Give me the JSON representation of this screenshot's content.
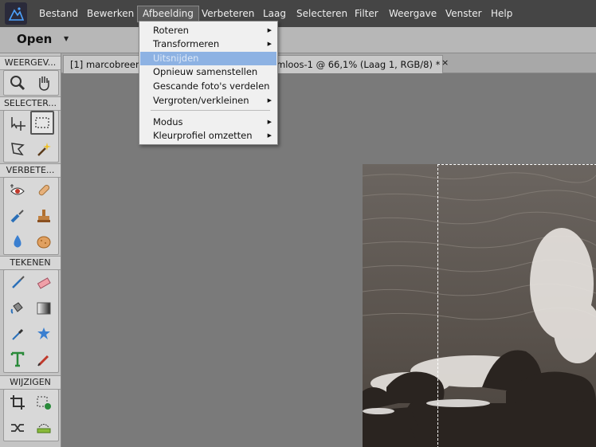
{
  "menubar": {
    "items": [
      "Bestand",
      "Bewerken",
      "Afbeelding",
      "Verbeteren",
      "Laag",
      "Selecteren",
      "Filter",
      "Weergave",
      "Venster",
      "Help"
    ]
  },
  "toolbar": {
    "open_label": "Open",
    "open_arrow": "▼"
  },
  "dropdown": {
    "items": [
      {
        "label": "Roteren",
        "has_sub": true
      },
      {
        "label": "Transformeren",
        "has_sub": true
      },
      {
        "label": "Uitsnijden",
        "has_sub": false,
        "highlighted": true
      },
      {
        "label": "Opnieuw samenstellen",
        "has_sub": false
      },
      {
        "label": "Gescande foto's verdelen",
        "has_sub": false
      },
      {
        "label": "Vergroten/verkleinen",
        "has_sub": true
      },
      {
        "label": "Modus",
        "has_sub": true
      },
      {
        "label": "Kleurprofiel omzetten",
        "has_sub": true
      }
    ],
    "arrow": "▶"
  },
  "tabs": [
    {
      "label": "[1] marcobreen.",
      "close": ""
    },
    {
      "label": "mloos-1 @ 66,1% (Laag 1, RGB/8) *",
      "close": "×"
    }
  ],
  "toolpanel": {
    "sections": [
      "WEERGEV...",
      "SELECTER...",
      "VERBETE...",
      "TEKENEN",
      "WIJZIGEN"
    ]
  },
  "colors": {
    "menubar": "#454545",
    "highlight": "#8db2e3",
    "panel": "#c4c4c4",
    "canvas": "#7a7a7a"
  }
}
